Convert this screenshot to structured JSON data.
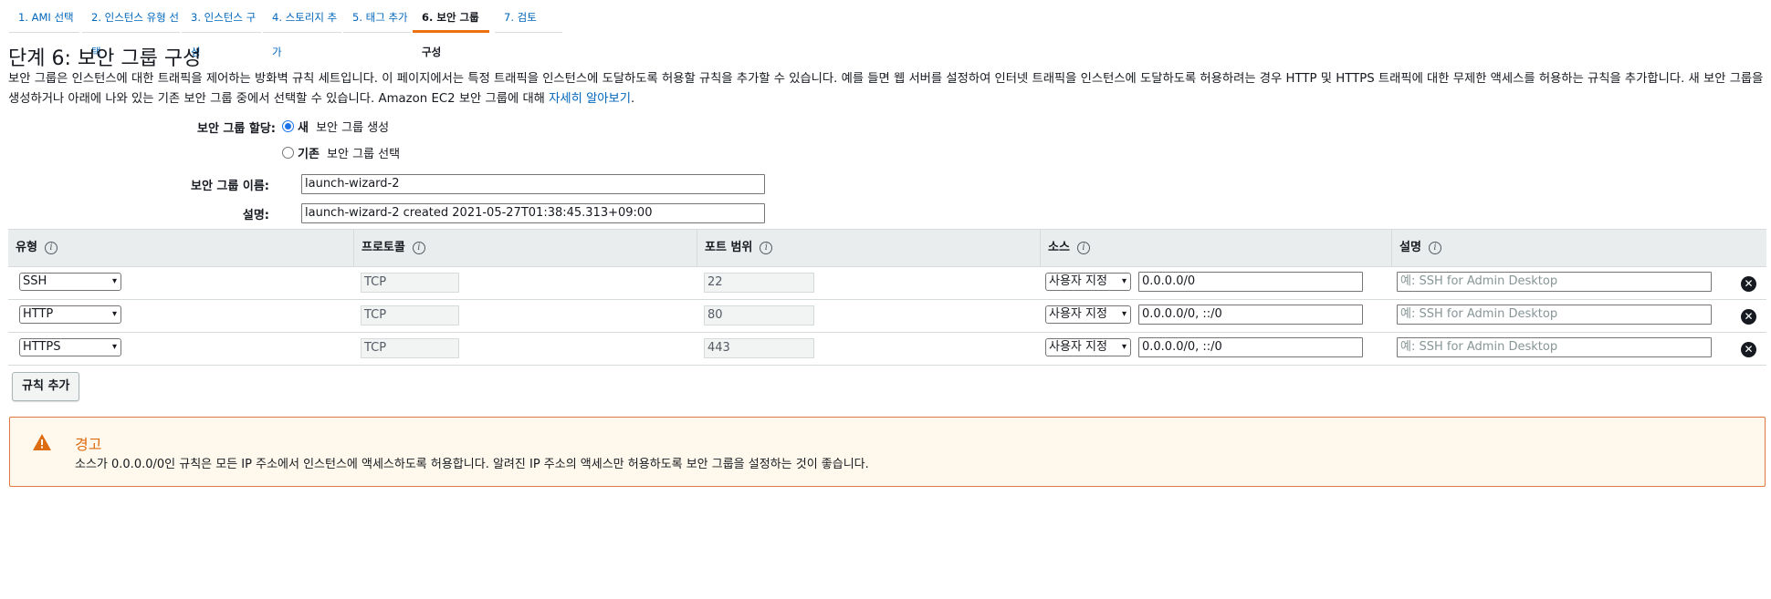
{
  "steps": [
    {
      "label": "1. AMI 선택"
    },
    {
      "label": "2. 인스턴스 유형 선택"
    },
    {
      "label": "3. 인스턴스 구성"
    },
    {
      "label": "4. 스토리지 추가"
    },
    {
      "label": "5. 태그 추가"
    },
    {
      "label": "6. 보안 그룹 구성",
      "active": true
    },
    {
      "label": "7. 검토"
    }
  ],
  "page": {
    "title": "단계 6: 보안 그룹 구성",
    "intro": "보안 그룹은 인스턴스에 대한 트래픽을 제어하는 방화벽 규칙 세트입니다. 이 페이지에서는 특정 트래픽을 인스턴스에 도달하도록 허용할 규칙을 추가할 수 있습니다. 예를 들면 웹 서버를 설정하여 인터넷 트래픽을 인스턴스에 도달하도록 허용하려는 경우 HTTP 및 HTTPS 트래픽에 대한 무제한 액세스를 허용하는 규칙을 추가합니다. 새 보안 그룹을 생성하거나 아래에 나와 있는 기존 보안 그룹 중에서 선택할 수 있습니다. Amazon EC2 보안 그룹에 대해 ",
    "learn_more": "자세히 알아보기",
    "intro_end": "."
  },
  "assign": {
    "label": "보안 그룹 할당:",
    "option_new_bold": "새",
    "option_new_rest": " 보안 그룹 생성",
    "option_existing_bold": "기존",
    "option_existing_rest": " 보안 그룹 선택",
    "selected": "new"
  },
  "group_name": {
    "label": "보안 그룹 이름:",
    "value": "launch-wizard-2"
  },
  "description": {
    "label": "설명:",
    "value": "launch-wizard-2 created 2021-05-27T01:38:45.313+09:00"
  },
  "table": {
    "headers": [
      "유형",
      "프로토콜",
      "포트 범위",
      "소스",
      "설명"
    ],
    "rows": [
      {
        "type": "SSH",
        "protocol": "TCP",
        "port": "22",
        "source_type": "사용자 지정",
        "source": "0.0.0.0/0",
        "desc_placeholder": "예: SSH for Admin Desktop"
      },
      {
        "type": "HTTP",
        "protocol": "TCP",
        "port": "80",
        "source_type": "사용자 지정",
        "source": "0.0.0.0/0, ::/0",
        "desc_placeholder": "예: SSH for Admin Desktop"
      },
      {
        "type": "HTTPS",
        "protocol": "TCP",
        "port": "443",
        "source_type": "사용자 지정",
        "source": "0.0.0.0/0, ::/0",
        "desc_placeholder": "예: SSH for Admin Desktop"
      }
    ]
  },
  "add_rule_label": "규칙 추가",
  "warning": {
    "title": "경고",
    "text": "소스가 0.0.0.0/0인 규칙은 모든 IP 주소에서 인스턴스에 액세스하도록 허용합니다. 알려진 IP 주소의 액세스만 허용하도록 보안 그룹을 설정하는 것이 좋습니다."
  },
  "colors": {
    "accent": "#ec7211",
    "link": "#0066bb",
    "warning_border": "#e07941",
    "warning_bg": "#fef9ec"
  }
}
